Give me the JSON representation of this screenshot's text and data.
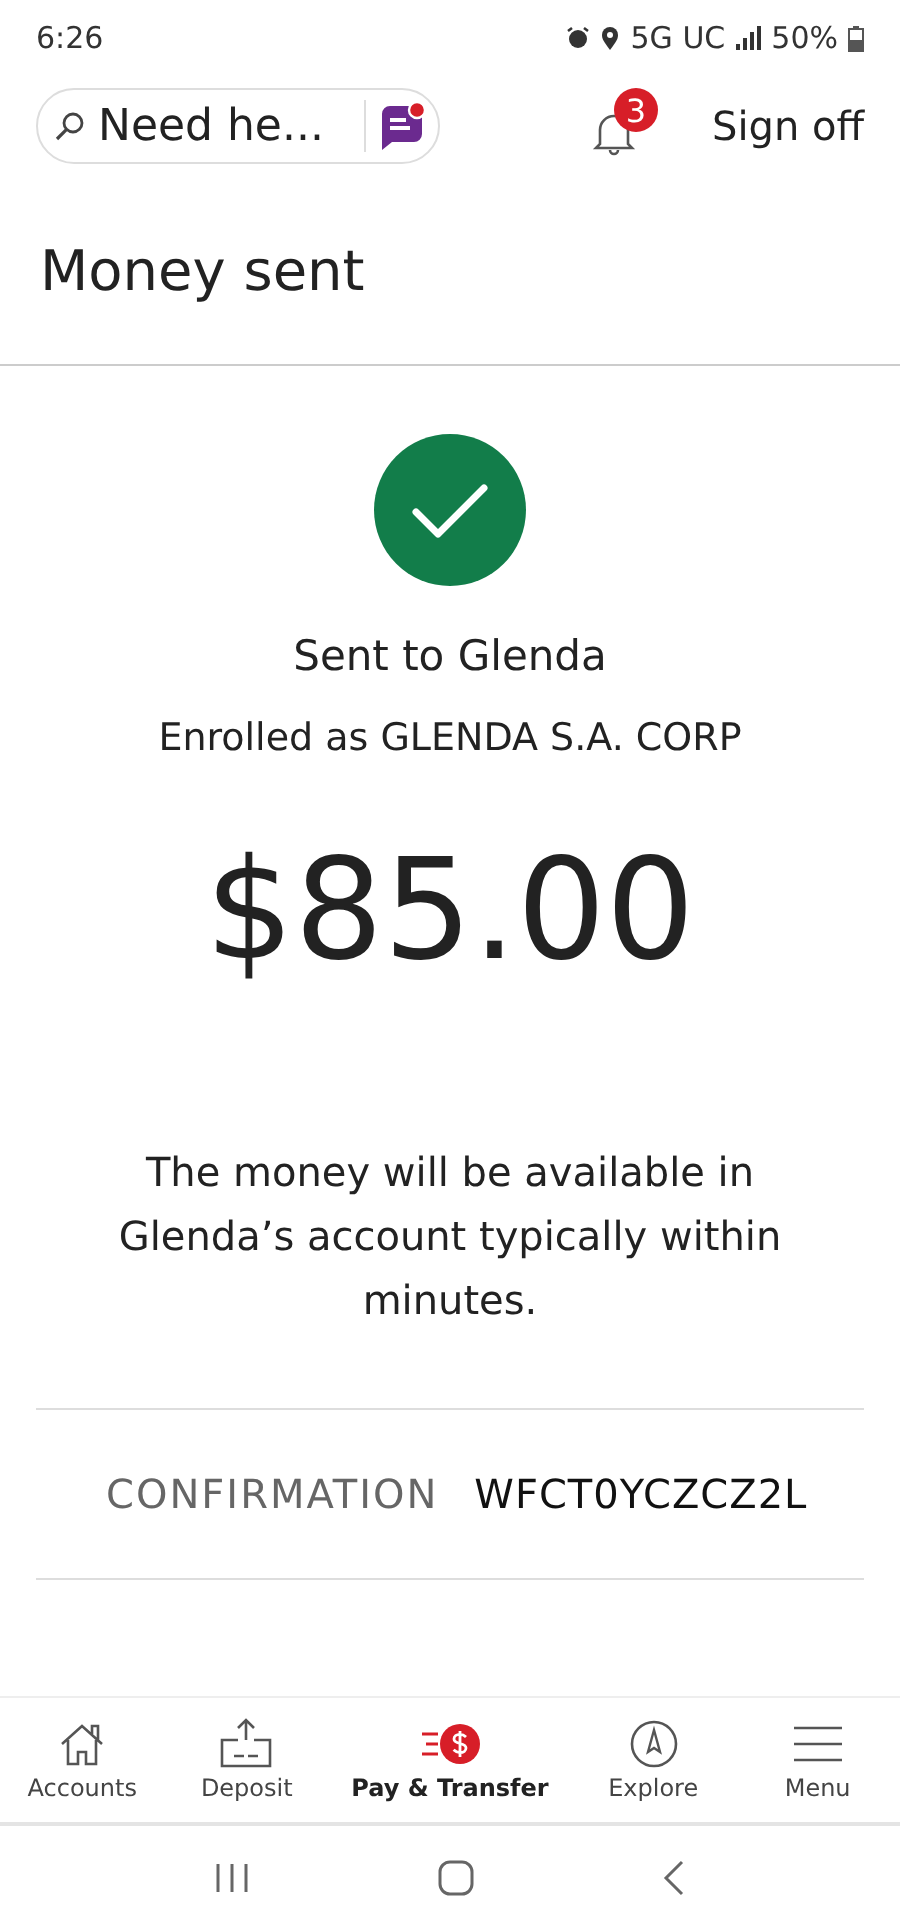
{
  "status_bar": {
    "time": "6:26",
    "network": "5G UC",
    "battery": "50%"
  },
  "header": {
    "search": {
      "placeholder": "Need he..."
    },
    "notifications": "3",
    "sign_off": "Sign off"
  },
  "title": "Money sent",
  "result": {
    "recipient": "Sent to Glenda",
    "enrolled": "Enrolled as GLENDA S.A. CORP",
    "amount": "$85.00",
    "message": "The money will be available in Glenda’s account typically within minutes."
  },
  "confirmation": {
    "label": "CONFIRMATION",
    "value": "WFCT0YCZCZ2L"
  },
  "bottom_nav": [
    {
      "label": "Accounts",
      "selected": false
    },
    {
      "label": "Deposit",
      "selected": false
    },
    {
      "label": "Pay & Transfer",
      "selected": true
    },
    {
      "label": "Explore",
      "selected": false
    },
    {
      "label": "Menu",
      "selected": false
    }
  ]
}
